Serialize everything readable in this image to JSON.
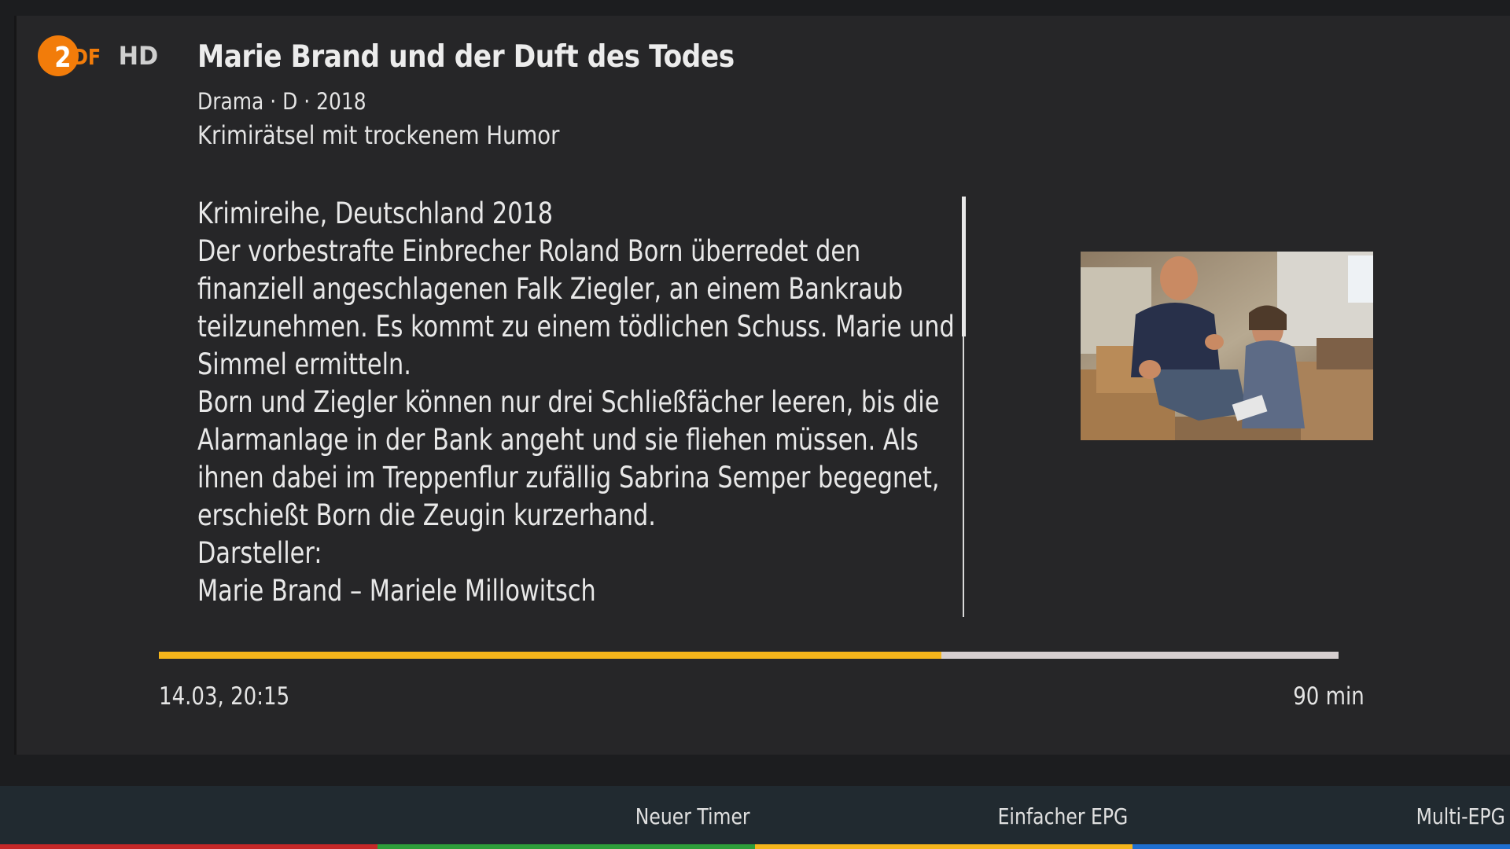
{
  "channel": {
    "logo_icon": "zdf-hd-logo",
    "logo_text": "ZDF HD"
  },
  "program": {
    "title": "Marie Brand und der Duft des Todes",
    "meta": "Drama · D · 2018",
    "subtitle": "Krimirätsel mit trockenem Humor",
    "description_lines": [
      "Krimireihe, Deutschland 2018",
      "Der vorbestrafte Einbrecher Roland Born überredet den",
      "finanziell angeschlagenen Falk Ziegler, an einem Bankraub",
      "teilzunehmen. Es kommt zu einem tödlichen Schuss. Marie und",
      "Simmel ermitteln.",
      "Born und Ziegler können nur drei Schließfächer leeren, bis die",
      "Alarmanlage in der Bank angeht und sie fliehen müssen. Als",
      "ihnen dabei im Treppenflur zufällig Sabrina Semper begegnet,",
      "erschießt Born die Zeugin kurzerhand.",
      "Darsteller:",
      "Marie Brand – Mariele Millowitsch"
    ],
    "image_icon": "program-still-image"
  },
  "progress": {
    "fraction": 0.663,
    "start": "14.03, 20:15",
    "duration": "90 min"
  },
  "footer": {
    "buttons": [
      {
        "label": "",
        "color": "#c62828"
      },
      {
        "label": "Neuer Timer",
        "color": "#2e9e3a"
      },
      {
        "label": "Einfacher EPG",
        "color": "#f5b51b"
      },
      {
        "label": "Multi-EPG",
        "color": "#1e6fd0"
      }
    ]
  },
  "colors": {
    "background": "#1c1d1f",
    "panel": "#262628",
    "accent": "#f5b51b",
    "footer": "#212a30"
  }
}
